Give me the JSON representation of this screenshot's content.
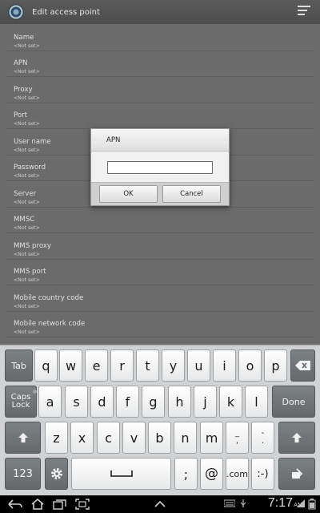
{
  "header": {
    "title": "Edit access point"
  },
  "list": [
    {
      "label": "Name",
      "value": "<Not set>"
    },
    {
      "label": "APN",
      "value": "<Not set>"
    },
    {
      "label": "Proxy",
      "value": "<Not set>"
    },
    {
      "label": "Port",
      "value": "<Not set>"
    },
    {
      "label": "User name",
      "value": "<Not set>"
    },
    {
      "label": "Password",
      "value": "<Not set>"
    },
    {
      "label": "Server",
      "value": "<Not set>"
    },
    {
      "label": "MMSC",
      "value": "<Not set>"
    },
    {
      "label": "MMS proxy",
      "value": "<Not set>"
    },
    {
      "label": "MMS port",
      "value": "<Not set>"
    },
    {
      "label": "Mobile country code",
      "value": "<Not set>"
    },
    {
      "label": "Mobile network code",
      "value": "<Not set>"
    }
  ],
  "dialog": {
    "title": "APN",
    "input_value": "",
    "ok": "OK",
    "cancel": "Cancel"
  },
  "keyboard": {
    "tab": "Tab",
    "row1": [
      "q",
      "w",
      "e",
      "r",
      "t",
      "y",
      "u",
      "i",
      "o",
      "p"
    ],
    "caps_top": "Caps",
    "caps_bottom": "Lock",
    "row2": [
      "a",
      "s",
      "d",
      "f",
      "g",
      "h",
      "j",
      "k",
      "l"
    ],
    "done": "Done",
    "row3": [
      "z",
      "x",
      "c",
      "v",
      "b",
      "n",
      "m"
    ],
    "underscore_top": "_",
    "underscore_bottom": ",",
    "dash_top": "-",
    "dash_bottom": ".",
    "num": "123",
    "semicolon": ";",
    "at": "@",
    "dotcom": ".com",
    "smiley": ":-)"
  },
  "status": {
    "time": "7:17",
    "ampm": "AM"
  }
}
